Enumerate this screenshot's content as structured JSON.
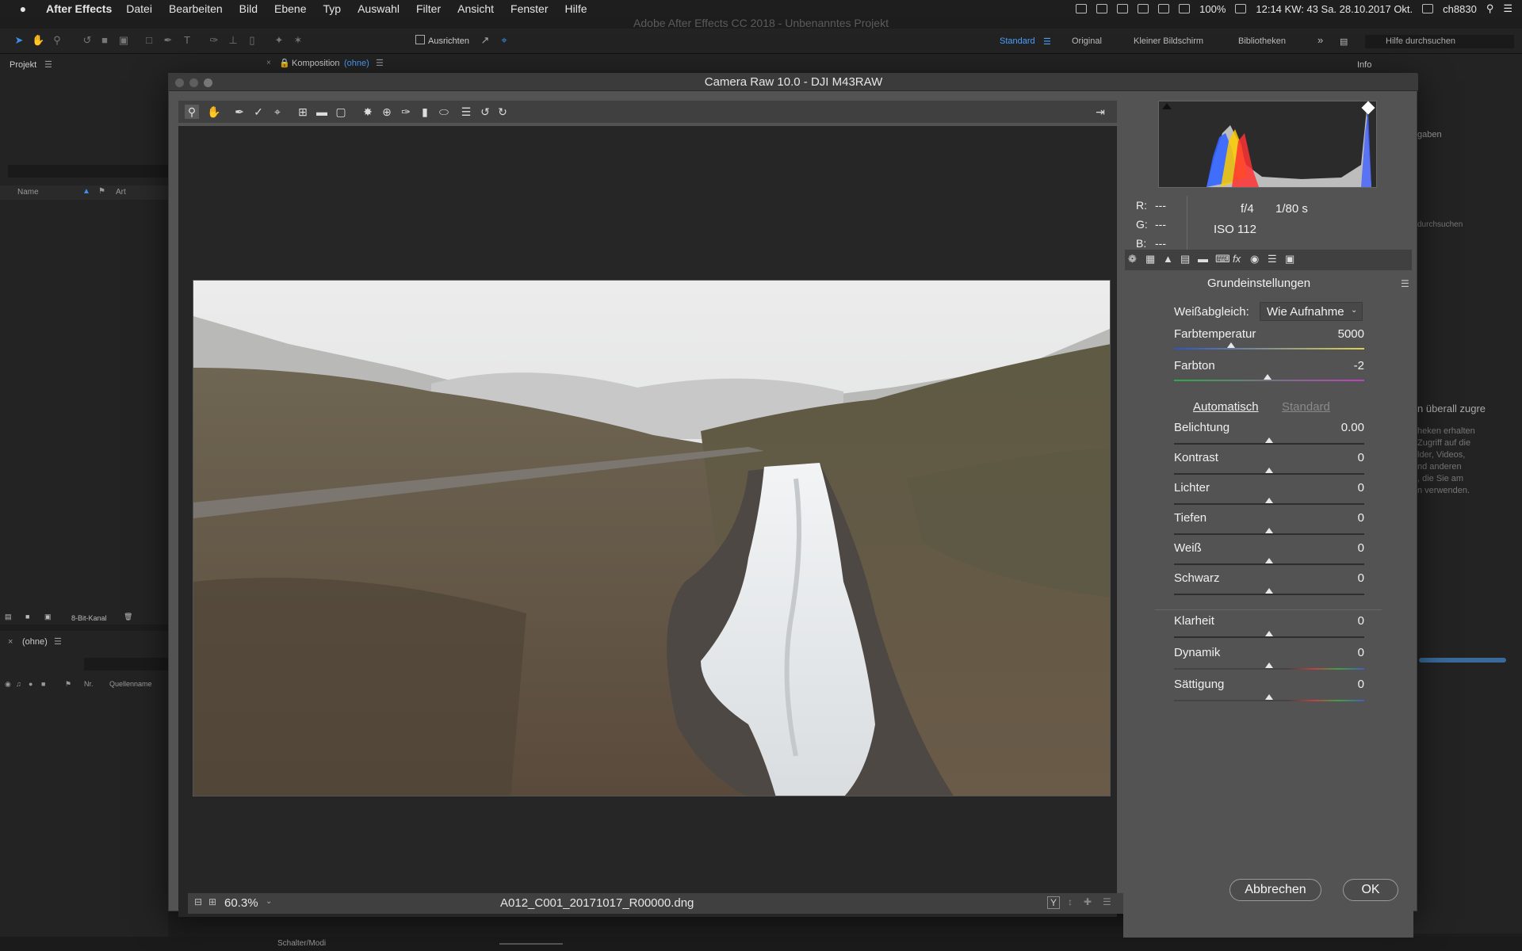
{
  "menubar": {
    "app": "After Effects",
    "items": [
      "Datei",
      "Bearbeiten",
      "Bild",
      "Ebene",
      "Typ",
      "Auswahl",
      "Filter",
      "Ansicht",
      "Fenster",
      "Hilfe"
    ],
    "battery": "100%",
    "datetime": "12:14 KW: 43 Sa. 28.10.2017 Okt.",
    "user": "ch8830"
  },
  "ae": {
    "window_title": "Adobe After Effects CC 2018 - Unbenanntes Projekt",
    "ausrichten_label": "Ausrichten",
    "workspaces": [
      "Standard",
      "Original",
      "Kleiner Bildschirm",
      "Bibliotheken"
    ],
    "search_placeholder": "Hilfe durchsuchen",
    "project_tab": "Projekt",
    "comp_tab": "Komposition",
    "comp_name": "(ohne)",
    "info_tab": "Info",
    "col_name": "Name",
    "col_art": "Art",
    "bit_depth": "8-Bit-Kanal",
    "timeline_tab": "(ohne)",
    "col_nr": "Nr.",
    "col_source": "Quellenname",
    "schalter": "Schalter/Modi",
    "right_snippets": [
      "gaben",
      "n überall zugre",
      "heken erhalten",
      "Zugriff auf die",
      "lder, Videos,",
      "nd anderen",
      ", die Sie am",
      "n verwenden.",
      "durchsuchen"
    ]
  },
  "dialog": {
    "title": "Camera Raw 10.0 - DJI M43RAW",
    "zoom": "60.3%",
    "filename": "A012_C001_20171017_R00000.dng",
    "rgb": {
      "r_label": "R:",
      "g_label": "G:",
      "b_label": "B:",
      "r": "---",
      "g": "---",
      "b": "---"
    },
    "exif": {
      "aperture": "f/4",
      "shutter": "1/80 s",
      "iso": "ISO 112"
    },
    "panel_title": "Grundeinstellungen",
    "white_balance_label": "Weißabgleich:",
    "white_balance_value": "Wie Aufnahme",
    "auto_label": "Automatisch",
    "default_label": "Standard",
    "sliders": [
      {
        "label": "Farbtemperatur",
        "value": "5000",
        "pos": 0.3
      },
      {
        "label": "Farbton",
        "value": "-2",
        "pos": 0.49
      },
      {
        "label": "Belichtung",
        "value": "0.00",
        "pos": 0.5
      },
      {
        "label": "Kontrast",
        "value": "0",
        "pos": 0.5
      },
      {
        "label": "Lichter",
        "value": "0",
        "pos": 0.5
      },
      {
        "label": "Tiefen",
        "value": "0",
        "pos": 0.5
      },
      {
        "label": "Weiß",
        "value": "0",
        "pos": 0.5
      },
      {
        "label": "Schwarz",
        "value": "0",
        "pos": 0.5
      },
      {
        "label": "Klarheit",
        "value": "0",
        "pos": 0.5
      },
      {
        "label": "Dynamik",
        "value": "0",
        "pos": 0.5
      },
      {
        "label": "Sättigung",
        "value": "0",
        "pos": 0.5
      }
    ],
    "cancel_label": "Abbrechen",
    "ok_label": "OK"
  },
  "colors": {
    "accent": "#2d8ceb",
    "dialog_bg": "#535353",
    "preview_bg": "#262626"
  }
}
